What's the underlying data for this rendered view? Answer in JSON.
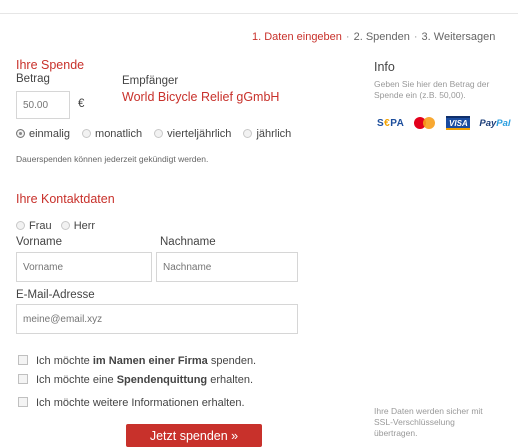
{
  "steps": {
    "step1": "1. Daten eingeben",
    "step2": "2. Spenden",
    "step3": "3. Weitersagen",
    "separator": "·"
  },
  "donation": {
    "heading": "Ihre Spende",
    "amount_label": "Betrag",
    "amount_placeholder": "50.00",
    "currency": "€",
    "recipient_label": "Empfänger",
    "recipient_name": "World Bicycle Relief gGmbH",
    "frequency_options": [
      "einmalig",
      "monatlich",
      "vierteljährlich",
      "jährlich"
    ],
    "frequency_selected": "einmalig",
    "note": "Dauerspenden können jederzeit gekündigt werden."
  },
  "info": {
    "heading": "Info",
    "text_line1": "Geben Sie hier den Betrag der",
    "text_line2": "Spende ein (z.B. 50,00).",
    "payment_methods": [
      "SEPA",
      "MasterCard",
      "VISA",
      "PayPal"
    ],
    "ssl_line1": "Ihre Daten werden sicher mit",
    "ssl_line2": "SSL-Verschlüsselung",
    "ssl_line3": "übertragen."
  },
  "contact": {
    "heading": "Ihre Kontaktdaten",
    "salutations": [
      "Frau",
      "Herr"
    ],
    "firstname_label": "Vorname",
    "firstname_placeholder": "Vorname",
    "lastname_label": "Nachname",
    "lastname_placeholder": "Nachname",
    "email_label": "E-Mail-Adresse",
    "email_placeholder": "meine@email.xyz"
  },
  "checkboxes": {
    "company_pre": "Ich möchte ",
    "company_bold": "im Namen einer Firma",
    "company_post": " spenden.",
    "receipt_pre": "Ich möchte eine ",
    "receipt_bold": "Spendenquittung",
    "receipt_post": " erhalten.",
    "info_text": "Ich möchte weitere Informationen erhalten."
  },
  "submit": {
    "label": "Jetzt spenden »"
  },
  "colors": {
    "accent": "#c8312b"
  }
}
